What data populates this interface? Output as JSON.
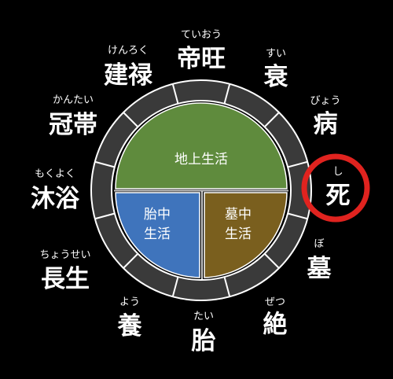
{
  "colors": {
    "background": "#000000",
    "ring": "#3a3a3a",
    "ring_border": "#ffffff",
    "above_ground": "#5f8b3d",
    "womb": "#3f74bc",
    "grave": "#7a5f1e",
    "highlight": "#e0231f"
  },
  "stages": [
    {
      "kanji": "帝旺",
      "reading": "ていおう"
    },
    {
      "kanji": "衰",
      "reading": "すい"
    },
    {
      "kanji": "病",
      "reading": "びょう"
    },
    {
      "kanji": "死",
      "reading": "し",
      "highlighted": true
    },
    {
      "kanji": "墓",
      "reading": "ぼ"
    },
    {
      "kanji": "絶",
      "reading": "ぜつ"
    },
    {
      "kanji": "胎",
      "reading": "たい"
    },
    {
      "kanji": "養",
      "reading": "よう"
    },
    {
      "kanji": "長生",
      "reading": "ちょうせい"
    },
    {
      "kanji": "沐浴",
      "reading": "もくよく"
    },
    {
      "kanji": "冠帯",
      "reading": "かんたい"
    },
    {
      "kanji": "建禄",
      "reading": "けんろく"
    }
  ],
  "regions": {
    "above_ground": "地上生活",
    "womb": [
      "胎中",
      "生活"
    ],
    "grave": [
      "墓中",
      "生活"
    ]
  }
}
